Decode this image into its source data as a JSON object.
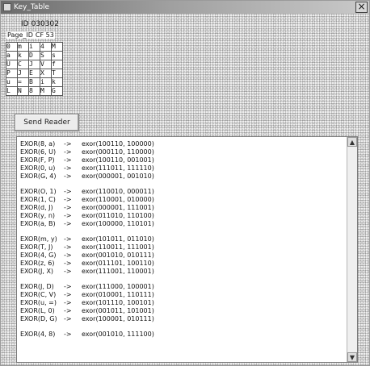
{
  "window": {
    "title": "Key_Table",
    "close_label": "×"
  },
  "user": {
    "id_label": "ID",
    "id_value": "030302"
  },
  "page": {
    "label": "Page_ID",
    "value": "CF 53"
  },
  "key_table": [
    [
      "0",
      "m",
      "i",
      "4",
      "M"
    ],
    [
      "a",
      "k",
      "D",
      "S",
      "s"
    ],
    [
      "U",
      "C",
      "J",
      "V",
      "f"
    ],
    [
      "P",
      "J",
      "E",
      "X",
      "T"
    ],
    [
      "u",
      "=",
      "B",
      "i",
      "k"
    ],
    [
      "L",
      "N",
      "8",
      "M",
      "G"
    ]
  ],
  "send_button": "Send Reader",
  "log": {
    "groups": [
      [
        {
          "op": "EXOR(8, a)",
          "arrow": "->",
          "res": "exor(100110, 100000)"
        },
        {
          "op": "EXOR(6, U)",
          "arrow": "->",
          "res": "exor(000110, 110000)"
        },
        {
          "op": "EXOR(F, P)",
          "arrow": "->",
          "res": "exor(100110, 001001)"
        },
        {
          "op": "EXOR(0, u)",
          "arrow": "->",
          "res": "exor(111011, 111110)"
        },
        {
          "op": "EXOR(G, 4)",
          "arrow": "->",
          "res": "exor(000001, 001010)"
        }
      ],
      [
        {
          "op": "EXOR(O, 1)",
          "arrow": "->",
          "res": "exor(110010, 000011)"
        },
        {
          "op": "EXOR(1, C)",
          "arrow": "->",
          "res": "exor(110001, 010000)"
        },
        {
          "op": "EXOR(d, J)",
          "arrow": "->",
          "res": "exor(000001, 111001)"
        },
        {
          "op": "EXOR(y, n)",
          "arrow": "->",
          "res": "exor(011010, 110100)"
        },
        {
          "op": "EXOR(a, B)",
          "arrow": "->",
          "res": "exor(100000, 110101)"
        }
      ],
      [
        {
          "op": "EXOR(m, y)",
          "arrow": "->",
          "res": "exor(101011, 011010)"
        },
        {
          "op": "EXOR(T, J)",
          "arrow": "->",
          "res": "exor(110011, 111001)"
        },
        {
          "op": "EXOR(4, G)",
          "arrow": "->",
          "res": "exor(001010, 010111)"
        },
        {
          "op": "EXOR(z, 6)",
          "arrow": "->",
          "res": "exor(011101, 100110)"
        },
        {
          "op": "EXOR(J, X)",
          "arrow": "->",
          "res": "exor(111001, 110001)"
        }
      ],
      [
        {
          "op": "EXOR(J, D)",
          "arrow": "->",
          "res": "exor(111000, 100001)"
        },
        {
          "op": "EXOR(C, V)",
          "arrow": "->",
          "res": "exor(010001, 110111)"
        },
        {
          "op": "EXOR(u, =)",
          "arrow": "->",
          "res": "exor(101110, 100101)"
        },
        {
          "op": "EXOR(L, 0)",
          "arrow": "->",
          "res": "exor(001011, 101001)"
        },
        {
          "op": "EXOR(D, G)",
          "arrow": "->",
          "res": "exor(100001, 010111)"
        }
      ],
      [
        {
          "op": "EXOR(4, 8)",
          "arrow": "->",
          "res": "exor(001010, 111100)"
        }
      ]
    ]
  },
  "scroll": {
    "up": "▲",
    "down": "▼"
  }
}
